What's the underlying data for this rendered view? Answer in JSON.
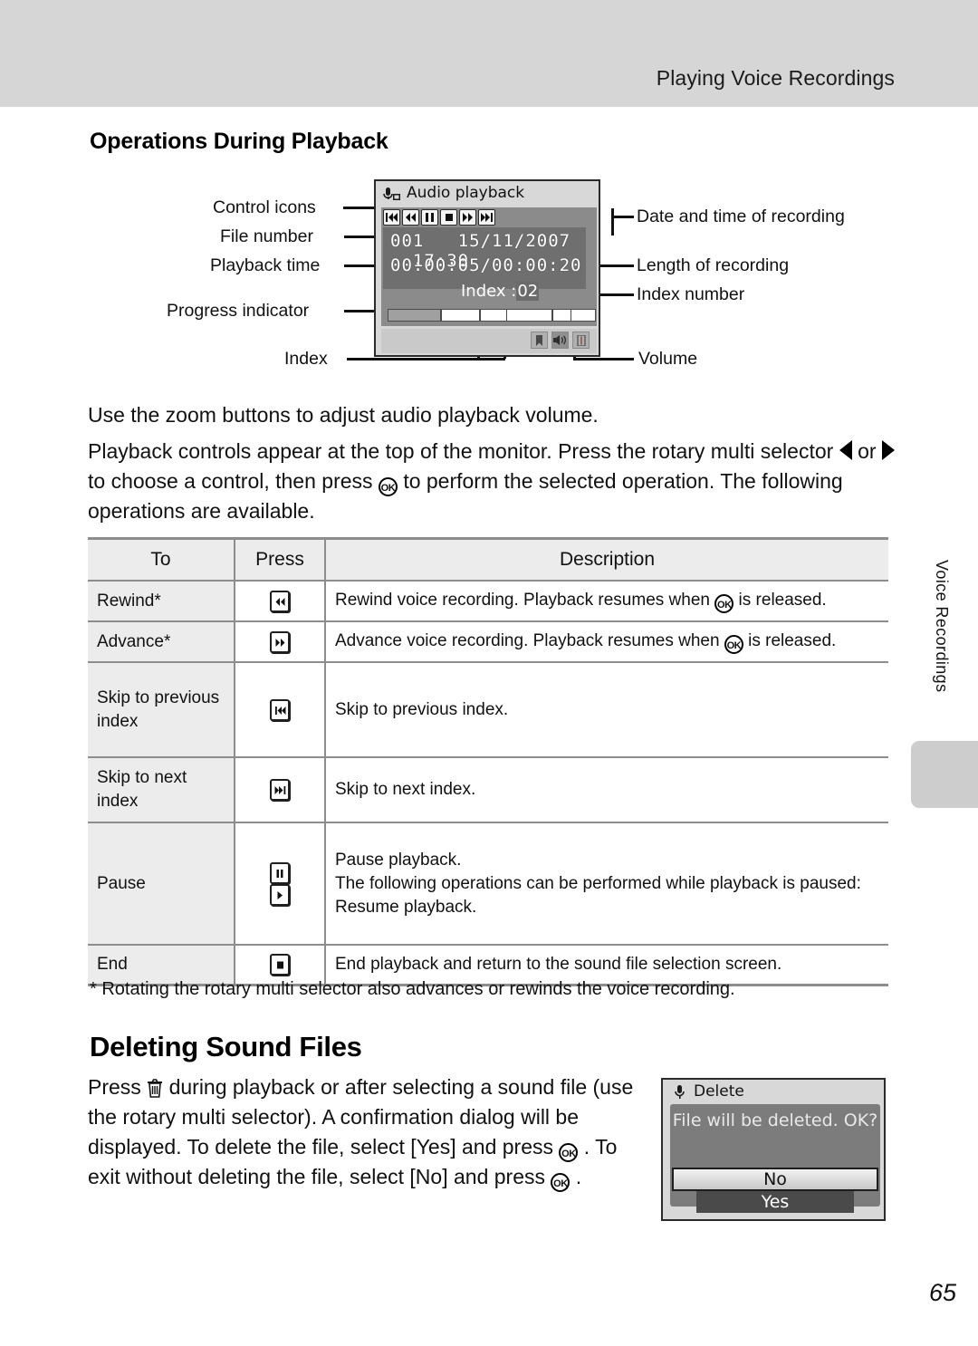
{
  "header": {
    "title": "Playing Voice Recordings"
  },
  "section": {
    "heading": "Operations During Playback"
  },
  "figure": {
    "callouts_left": [
      {
        "label": "Control icons"
      },
      {
        "label": "File number"
      },
      {
        "label": "Playback time"
      },
      {
        "label": "Progress indicator"
      },
      {
        "label": "Index"
      }
    ],
    "callouts_right": [
      {
        "label": "Date and time of recording"
      },
      {
        "label": "Length of recording"
      },
      {
        "label": "Index number"
      },
      {
        "label": "Volume"
      }
    ],
    "monitor": {
      "title": "Audio playback",
      "mic_icon": "microphone-icon",
      "control_icons": [
        "skip-previous-icon",
        "rewind-icon",
        "pause-icon",
        "stop-icon",
        "advance-icon",
        "skip-next-icon"
      ],
      "file_number": "001",
      "date": "15/11/2007",
      "time": "17:30",
      "playback_time": "00:00:05",
      "length_of_recording": "00:00:20",
      "index_label": "Index :",
      "index_number": "02",
      "progress_percent": 25,
      "index_marks_percent": [
        25,
        44,
        57,
        79,
        88
      ],
      "footer_icons": [
        "bookmark-icon",
        "speaker-icon",
        "battery-icon"
      ]
    }
  },
  "body": {
    "p1": "Use the zoom buttons to adjust audio playback volume.",
    "p2_a": "Playback controls appear at the top of the monitor. Press the rotary multi selector",
    "p2_or": "or",
    "p2_b": "to choose a control, then press",
    "p2_c": "to perform the selected operation. The following operations are available."
  },
  "table": {
    "headers": [
      "To",
      "Press",
      "Description"
    ],
    "rows": [
      {
        "to": "Rewind*",
        "icons": [
          "rewind-icon"
        ],
        "desc_lines": [
          "Rewind voice recording. Playback resumes when ⟨OK⟩ is released."
        ],
        "desc_pre": "Rewind voice recording. Playback resumes when",
        "desc_post": "is released."
      },
      {
        "to": "Advance*",
        "icons": [
          "advance-icon"
        ],
        "desc_pre": "Advance voice recording. Playback resumes when",
        "desc_post": "is released."
      },
      {
        "to": "Skip to previous index",
        "icons": [
          "skip-previous-icon"
        ],
        "desc_plain": "Skip to previous index."
      },
      {
        "to": "Skip to next index",
        "icons": [
          "skip-next-icon"
        ],
        "desc_plain": "Skip to next index."
      },
      {
        "to": "Pause",
        "icons": [
          "pause-icon",
          "play-icon"
        ],
        "desc_l1": "Pause playback.",
        "desc_l2": "The following operations can be performed while playback is paused:",
        "desc_l3": "Resume playback."
      },
      {
        "to": "End",
        "icons": [
          "stop-icon"
        ],
        "desc_plain": "End playback and return to the sound file selection screen."
      }
    ]
  },
  "footnote": "*  Rotating the rotary multi selector also advances or rewinds the voice recording.",
  "deleting": {
    "heading": "Deleting Sound Files",
    "p_a": "Press",
    "p_b": "during playback or after selecting a sound file (use the rotary multi selector). A confirmation dialog will be displayed. To delete the file, select [Yes] and press",
    "p_c": ". To exit without deleting the file, select [No] and press",
    "p_d": ".",
    "dialog": {
      "title": "Delete",
      "mic_icon": "microphone-icon",
      "message": "File will be deleted. OK?",
      "option_no": "No",
      "option_yes": "Yes"
    }
  },
  "side_tab": {
    "label": "Voice Recordings"
  },
  "page_number": "65",
  "colors": {
    "header_bg": "#d6d6d6",
    "table_header_bg": "#ececec",
    "monitor_bg": "#d8d8d8",
    "monitor_panel": "#6f6f6f",
    "side_tab": "#cdcdcd"
  }
}
